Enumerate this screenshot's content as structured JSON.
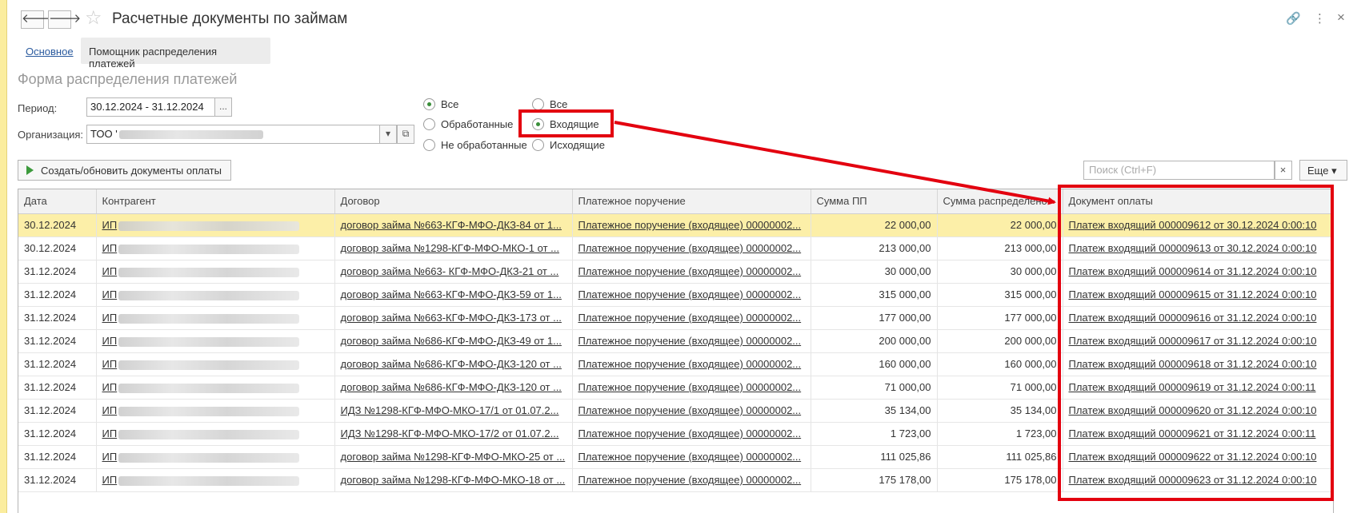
{
  "window": {
    "title": "Расчетные документы по займам",
    "back_glyph": "🡐",
    "forward_glyph": "🡒",
    "star_glyph": "☆",
    "link_glyph": "🔗",
    "menu_glyph": "⋮",
    "close_glyph": "×"
  },
  "tabs": {
    "main": "Основное",
    "assistant": "Помощник распределения платежей"
  },
  "form": {
    "title": "Форма распределения платежей",
    "period_label": "Период:",
    "period_value": "30.12.2024 - 31.12.2024",
    "period_btn": "...",
    "org_label": "Организация:",
    "org_value": "ТОО '",
    "org_dropdown_glyph": "▾",
    "org_open_glyph": "⧉"
  },
  "radios": {
    "group1": [
      {
        "label": "Все",
        "checked": true
      },
      {
        "label": "Обработанные",
        "checked": false
      },
      {
        "label": "Не обработанные",
        "checked": false
      }
    ],
    "group2": [
      {
        "label": "Все",
        "checked": false
      },
      {
        "label": "Входящие",
        "checked": true
      },
      {
        "label": "Исходящие",
        "checked": false
      }
    ]
  },
  "toolbar": {
    "create_label": "Создать/обновить документы оплаты",
    "search_placeholder": "Поиск (Ctrl+F)",
    "search_clear": "×",
    "more_label": "Еще ▾"
  },
  "table": {
    "columns": [
      "Дата",
      "Контрагент",
      "Договор",
      "Платежное поручение",
      "Сумма ПП",
      "Сумма распределено",
      "Документ оплаты"
    ],
    "rows": [
      {
        "date": "30.12.2024",
        "contractor": "ИП",
        "contract": "договор займа №663-КГФ-МФО-ДКЗ-84 от 1...",
        "order": "Платежное поручение (входящее) 00000002...",
        "sum_pp": "22 000,00",
        "sum_dist": "22 000,00",
        "doc": "Платеж входящий 000009612 от 30.12.2024 0:00:10"
      },
      {
        "date": "30.12.2024",
        "contractor": "ИП",
        "contract": "договор займа №1298-КГФ-МФО-МКО-1 от ...",
        "order": "Платежное поручение (входящее) 00000002...",
        "sum_pp": "213 000,00",
        "sum_dist": "213 000,00",
        "doc": "Платеж входящий 000009613 от 30.12.2024 0:00:10"
      },
      {
        "date": "31.12.2024",
        "contractor": "ИП",
        "contract": "договор займа №663- КГФ-МФО-ДКЗ-21 от ...",
        "order": "Платежное поручение (входящее) 00000002...",
        "sum_pp": "30 000,00",
        "sum_dist": "30 000,00",
        "doc": "Платеж входящий 000009614 от 31.12.2024 0:00:10"
      },
      {
        "date": "31.12.2024",
        "contractor": "ИП",
        "contract": "договор займа №663-КГФ-МФО-ДКЗ-59 от 1...",
        "order": "Платежное поручение (входящее) 00000002...",
        "sum_pp": "315 000,00",
        "sum_dist": "315 000,00",
        "doc": "Платеж входящий 000009615 от 31.12.2024 0:00:10"
      },
      {
        "date": "31.12.2024",
        "contractor": "ИП",
        "contract": "договор займа №663-КГФ-МФО-ДКЗ-173 от ...",
        "order": "Платежное поручение (входящее) 00000002...",
        "sum_pp": "177 000,00",
        "sum_dist": "177 000,00",
        "doc": "Платеж входящий 000009616 от 31.12.2024 0:00:10"
      },
      {
        "date": "31.12.2024",
        "contractor": "ИП",
        "contract": "договор займа №686-КГФ-МФО-ДКЗ-49 от 1...",
        "order": "Платежное поручение (входящее) 00000002...",
        "sum_pp": "200 000,00",
        "sum_dist": "200 000,00",
        "doc": "Платеж входящий 000009617 от 31.12.2024 0:00:10"
      },
      {
        "date": "31.12.2024",
        "contractor": "ИП",
        "contract": "договор займа №686-КГФ-МФО-ДКЗ-120 от ...",
        "order": "Платежное поручение (входящее) 00000002...",
        "sum_pp": "160 000,00",
        "sum_dist": "160 000,00",
        "doc": "Платеж входящий 000009618 от 31.12.2024 0:00:10"
      },
      {
        "date": "31.12.2024",
        "contractor": "ИП",
        "contract": "договор займа №686-КГФ-МФО-ДКЗ-120 от ...",
        "order": "Платежное поручение (входящее) 00000002...",
        "sum_pp": "71 000,00",
        "sum_dist": "71 000,00",
        "doc": "Платеж входящий 000009619 от 31.12.2024 0:00:11"
      },
      {
        "date": "31.12.2024",
        "contractor": "ИП",
        "contract": "ИДЗ №1298-КГФ-МФО-МКО-17/1 от 01.07.2...",
        "order": "Платежное поручение (входящее) 00000002...",
        "sum_pp": "35 134,00",
        "sum_dist": "35 134,00",
        "doc": "Платеж входящий 000009620 от 31.12.2024 0:00:10"
      },
      {
        "date": "31.12.2024",
        "contractor": "ИП",
        "contract": "ИДЗ №1298-КГФ-МФО-МКО-17/2 от 01.07.2...",
        "order": "Платежное поручение (входящее) 00000002...",
        "sum_pp": "1 723,00",
        "sum_dist": "1 723,00",
        "doc": "Платеж входящий 000009621 от 31.12.2024 0:00:11"
      },
      {
        "date": "31.12.2024",
        "contractor": "ИП",
        "contract": "договор займа №1298-КГФ-МФО-МКО-25 от ...",
        "order": "Платежное поручение (входящее) 00000002...",
        "sum_pp": "111 025,86",
        "sum_dist": "111 025,86",
        "doc": "Платеж входящий 000009622 от 31.12.2024 0:00:10"
      },
      {
        "date": "31.12.2024",
        "contractor": "ИП",
        "contract": "договор займа №1298-КГФ-МФО-МКО-18 от ...",
        "order": "Платежное поручение (входящее) 00000002...",
        "sum_pp": "175 178,00",
        "sum_dist": "175 178,00",
        "doc": "Платеж входящий 000009623 от 31.12.2024 0:00:10"
      }
    ]
  },
  "colors": {
    "accent_yellow": "#fcefa8",
    "highlight_red": "#e3000f",
    "link_blue": "#2a5a9e",
    "radio_green": "#3a8e3a"
  }
}
